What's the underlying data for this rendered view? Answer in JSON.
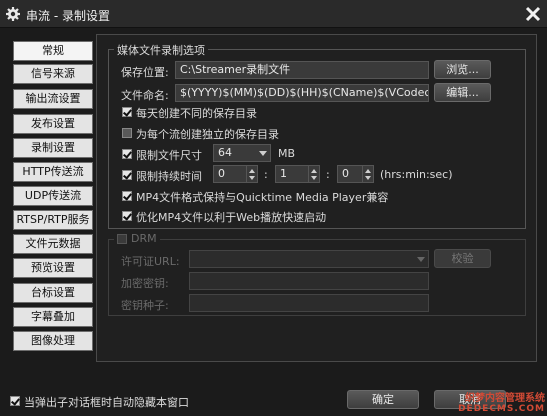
{
  "window": {
    "title": "串流 - 录制设置",
    "icon": "gear-icon",
    "close": "close-icon"
  },
  "sidebar": {
    "items": [
      {
        "label": "常规",
        "active": true
      },
      {
        "label": "信号来源"
      },
      {
        "label": "输出流设置"
      },
      {
        "label": "发布设置"
      },
      {
        "label": "录制设置"
      },
      {
        "label": "HTTP传送流"
      },
      {
        "label": "UDP传送流"
      },
      {
        "label": "RTSP/RTP服务"
      },
      {
        "label": "文件元数据"
      },
      {
        "label": "预览设置"
      },
      {
        "label": "台标设置"
      },
      {
        "label": "字幕叠加"
      },
      {
        "label": "图像处理"
      }
    ]
  },
  "media_group": {
    "title": "媒体文件录制选项",
    "save_location_label": "保存位置:",
    "save_location_value": "C:\\Streamer录制文件",
    "browse_button": "浏览...",
    "filename_label": "文件命名:",
    "filename_value": "$(YYYY)$(MM)$(DD)$(HH)$(CName)$(VCodec)$(ACodec)",
    "edit_button": "编辑...",
    "daily_dir_label": "每天创建不同的保存目录",
    "daily_dir_checked": true,
    "per_stream_dir_label": "为每个流创建独立的保存目录",
    "per_stream_dir_checked": false,
    "limit_size_label": "限制文件尺寸",
    "limit_size_checked": true,
    "limit_size_value": "64",
    "limit_size_unit": "MB",
    "limit_duration_label": "限制持续时间",
    "limit_duration_checked": true,
    "duration_h": "0",
    "duration_m": "1",
    "duration_s": "0",
    "colon": ":",
    "duration_format": "(hrs:min:sec)",
    "mp4_quicktime_label": "MP4文件格式保持与Quicktime Media Player兼容",
    "mp4_quicktime_checked": true,
    "mp4_web_label": "优化MP4文件以利于Web播放快速启动",
    "mp4_web_checked": true
  },
  "drm_group": {
    "title": "DRM",
    "checked": false,
    "license_url_label": "许可证URL:",
    "license_url_value": "",
    "check_button": "校验",
    "encrypt_key_label": "加密密钥:",
    "encrypt_key_value": "",
    "key_seed_label": "密钥种子:",
    "key_seed_value": ""
  },
  "footer": {
    "auto_hide_label": "当弹出子对话框时自动隐藏本窗口",
    "auto_hide_checked": true,
    "ok_button": "确定",
    "cancel_button": "取消"
  },
  "watermark": {
    "line1": "织梦内容管理系统",
    "line2": "DEDECMS.COM"
  },
  "colors": {
    "background": "#1b1b1b",
    "sidebar_button": "#e4e4e4",
    "field": "#3a3a3a",
    "watermark": "#c23a2a"
  }
}
